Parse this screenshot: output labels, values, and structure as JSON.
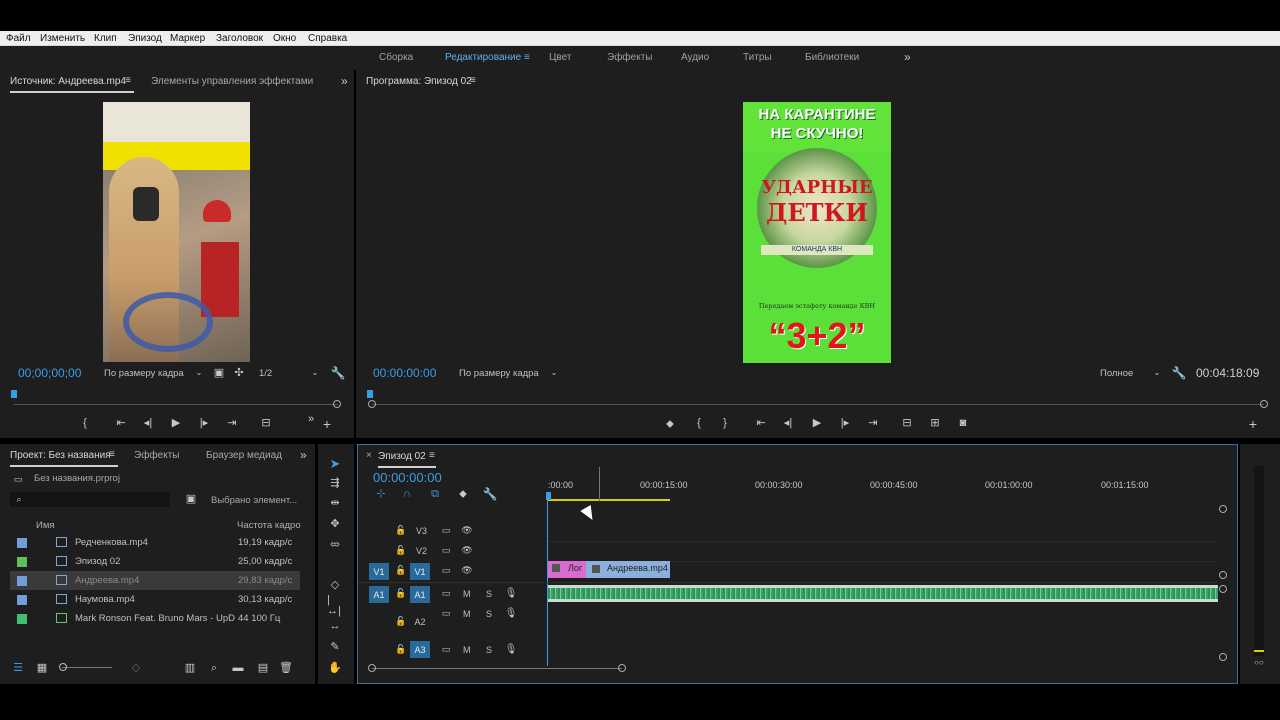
{
  "menu": [
    "Файл",
    "Изменить",
    "Клип",
    "Эпизод",
    "Маркер",
    "Заголовок",
    "Окно",
    "Справка"
  ],
  "workspaces": [
    "Сборка",
    "Редактирование",
    "Цвет",
    "Эффекты",
    "Аудио",
    "Титры",
    "Библиотеки"
  ],
  "active_workspace": "Редактирование",
  "source_panel": {
    "tab_source": "Источник: Андреева.mp4",
    "tab_effects": "Элементы управления эффектами",
    "timecode": "00;00;00;00",
    "fit": "По размеру кадра",
    "resolution": "1/2"
  },
  "program_panel": {
    "tab": "Программа: Эпизод 02",
    "timecode": "00:00:00:00",
    "fit": "По размеру кадра",
    "quality": "Полное",
    "duration": "00:04:18:09",
    "poster": {
      "line1": "НА КАРАНТИНЕ",
      "line2": "НЕ СКУЧНО!",
      "title1": "УДАРНЫЕ",
      "title2": "ДЕТКИ",
      "band": "КОМАНДА КВН",
      "small": "Передаем эстафету команде КВН",
      "big": "“3+2”"
    }
  },
  "project_panel": {
    "tab_project": "Проект: Без названия",
    "tab_effects": "Эффекты",
    "tab_browser": "Браузер медиаданных",
    "file": "Без названия.prproj",
    "selected_info": "Выбрано элемент...",
    "col_name": "Имя",
    "col_rate": "Частота кадров",
    "items": [
      {
        "name": "Редченкова.mp4",
        "rate": "19,19 кадр/с",
        "color": "#6f9fd8"
      },
      {
        "name": "Эпизод 02",
        "rate": "25,00 кадр/с",
        "color": "#5cc05c"
      },
      {
        "name": "Андреева.mp4",
        "rate": "29,83 кадр/с",
        "color": "#6f9fd8"
      },
      {
        "name": "Наумова.mp4",
        "rate": "30,13 кадр/с",
        "color": "#6f9fd8"
      },
      {
        "name": "Mark Ronson Feat. Bruno Mars - UpD",
        "rate": "44 100 Гц",
        "color": "#3fbf6f"
      }
    ]
  },
  "timeline": {
    "tab": "Эпизод 02",
    "timecode": "00:00:00:00",
    "ruler": [
      ":00:00",
      "00:00:15:00",
      "00:00:30:00",
      "00:00:45:00",
      "00:01:00:00",
      "00:01:15:00"
    ],
    "tracks_video": [
      "V3",
      "V2",
      "V1"
    ],
    "tracks_audio": [
      "A1",
      "A2",
      "A3"
    ],
    "clip1": "Лог",
    "clip2": "Андреева.mp4",
    "m": "M",
    "s": "S"
  }
}
